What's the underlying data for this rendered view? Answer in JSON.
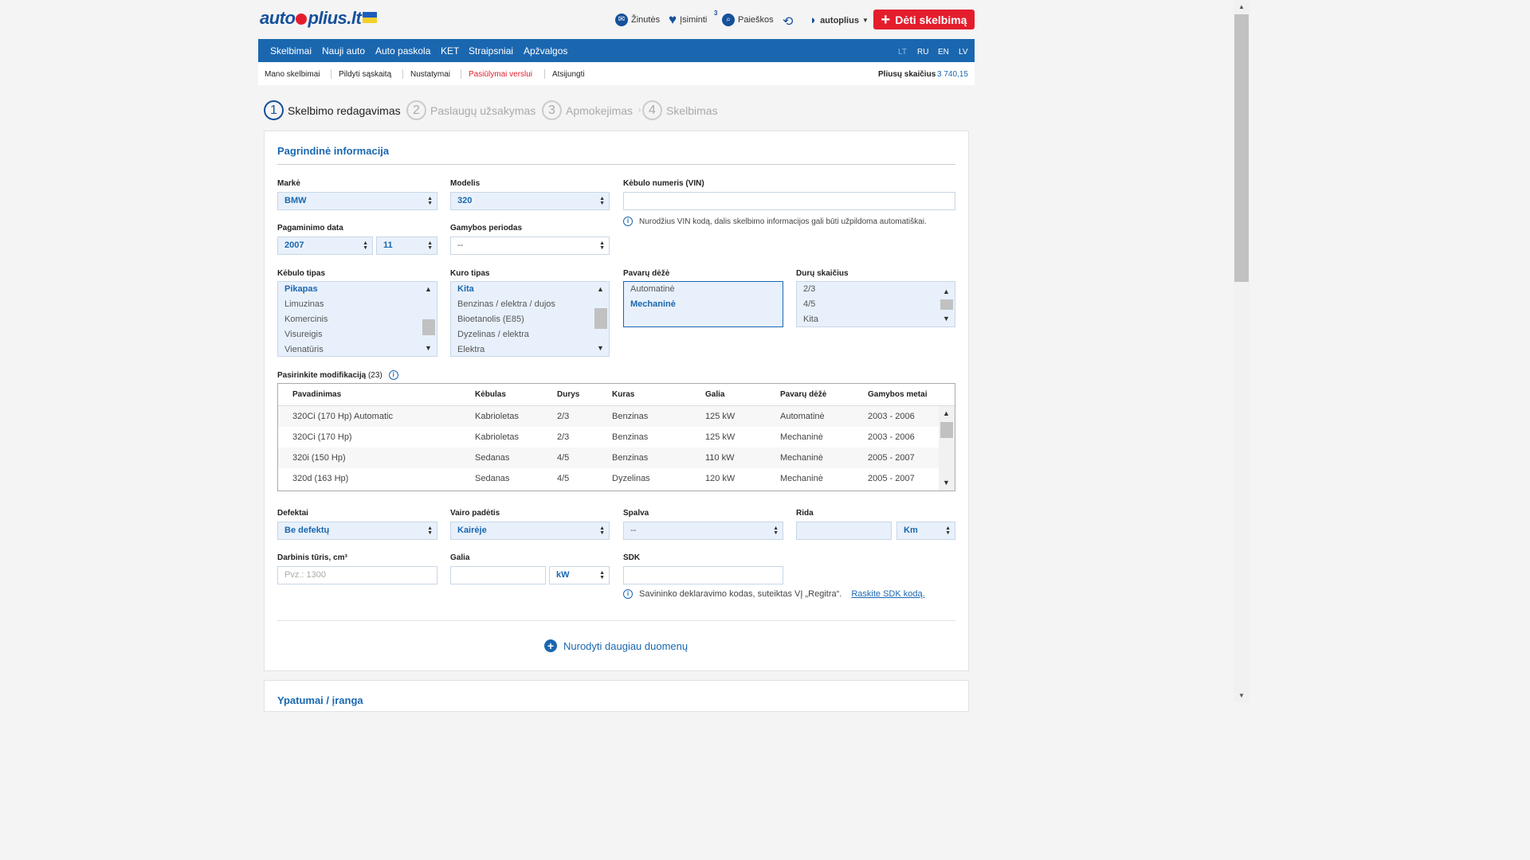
{
  "header": {
    "logo_text": "autoplius.lt",
    "messages_label": "Žinutės",
    "saved_label": "Įsiminti",
    "searches_label": "Paieškos",
    "searches_count": "3",
    "user_label": "autoplius",
    "post_button": "Dėti skelbimą"
  },
  "nav": {
    "items": [
      "Skelbimai",
      "Nauji auto",
      "Auto paskola",
      "KET",
      "Straipsniai",
      "Apžvalgos"
    ],
    "langs": [
      "LT",
      "RU",
      "EN",
      "LV"
    ],
    "active_lang": "LT"
  },
  "subnav": {
    "items": [
      "Mano skelbimai",
      "Pildyti sąskaitą",
      "Nustatymai",
      "Pasiūlymai verslui",
      "Atsijungti"
    ],
    "balance_label": "Pliusų skaičius",
    "balance_value": "3 740,15"
  },
  "steps": [
    {
      "num": "1",
      "label": "Skelbimo redagavimas"
    },
    {
      "num": "2",
      "label": "Paslaugų užsakymas"
    },
    {
      "num": "3",
      "label": "Apmokejimas"
    },
    {
      "num": "4",
      "label": "Skelbimas"
    }
  ],
  "form": {
    "section_title": "Pagrindinė informacija",
    "make": {
      "label": "Markė",
      "value": "BMW"
    },
    "model": {
      "label": "Modelis",
      "value": "320"
    },
    "vin": {
      "label": "Kėbulo numeris (VIN)",
      "value": "",
      "note": "Nurodžius VIN kodą, dalis skelbimo informacijos gali būti užpildoma automatiškai."
    },
    "manufacture": {
      "label": "Pagaminimo data",
      "year": "2007",
      "month": "11"
    },
    "period": {
      "label": "Gamybos periodas",
      "value": "--"
    },
    "body_type": {
      "label": "Kėbulo tipas",
      "options": [
        "Pikapas",
        "Limuzinas",
        "Komercinis",
        "Visureigis",
        "Vienatūris"
      ],
      "selected": "Pikapas"
    },
    "fuel_type": {
      "label": "Kuro tipas",
      "options": [
        "Kita",
        "Benzinas / elektra / dujos",
        "Bioetanolis (E85)",
        "Dyzelinas / elektra",
        "Elektra"
      ],
      "selected": "Kita"
    },
    "gearbox": {
      "label": "Pavarų dėžė",
      "options": [
        "Automatinė",
        "Mechaninė"
      ],
      "selected": "Mechaninė"
    },
    "doors": {
      "label": "Durų skaičius",
      "options": [
        "2/3",
        "4/5",
        "Kita"
      ]
    },
    "modifications": {
      "label": "Pasirinkite modifikaciją",
      "count": "(23)",
      "columns": [
        "Pavadinimas",
        "Kėbulas",
        "Durys",
        "Kuras",
        "Galia",
        "Pavarų dėžė",
        "Gamybos metai"
      ],
      "rows": [
        [
          "320Ci (170 Hp) Automatic",
          "Kabrioletas",
          "2/3",
          "Benzinas",
          "125 kW",
          "Automatinė",
          "2003 - 2006"
        ],
        [
          "320Ci (170 Hp)",
          "Kabrioletas",
          "2/3",
          "Benzinas",
          "125 kW",
          "Mechaninė",
          "2003 - 2006"
        ],
        [
          "320i (150 Hp)",
          "Sedanas",
          "4/5",
          "Benzinas",
          "110 kW",
          "Mechaninė",
          "2005 - 2007"
        ],
        [
          "320d (163 Hp)",
          "Sedanas",
          "4/5",
          "Dyzelinas",
          "120 kW",
          "Mechaninė",
          "2005 - 2007"
        ]
      ]
    },
    "defects": {
      "label": "Defektai",
      "value": "Be defektų"
    },
    "steering": {
      "label": "Vairo padėtis",
      "value": "Kairėje"
    },
    "color": {
      "label": "Spalva",
      "value": "--"
    },
    "mileage": {
      "label": "Rida",
      "value": "",
      "unit": "Km"
    },
    "engine": {
      "label": "Darbinis tūris, cm³",
      "placeholder": "Pvz.: 1300"
    },
    "power": {
      "label": "Galia",
      "value": "",
      "unit": "kW"
    },
    "sdk": {
      "label": "SDK",
      "value": "",
      "note": "Savininko deklaravimo kodas, suteiktas VĮ „Regitra“.",
      "link": "Raskite SDK kodą."
    },
    "more_button": "Nurodyti daugiau duomenų"
  },
  "next_section_title": "Ypatumai / įranga",
  "colors": {
    "brand_blue": "#1a67b0",
    "brand_red": "#e41d2d"
  }
}
